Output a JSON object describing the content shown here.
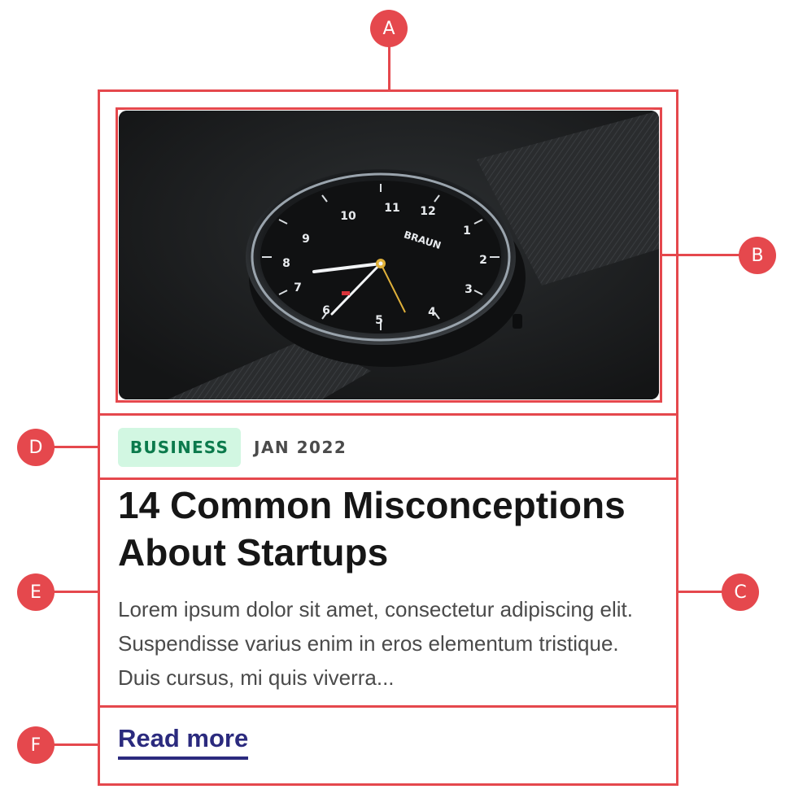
{
  "annotations": {
    "card": "A",
    "image": "B",
    "content": "C",
    "meta": "D",
    "text": "E",
    "action": "F",
    "color": "#e5484d"
  },
  "card": {
    "image": {
      "icon": "wristwatch-photo",
      "dial_brand": "BRAUN"
    },
    "category": "BUSINESS",
    "date": "JAN 2022",
    "title": "14 Common Misconceptions About Startups",
    "excerpt": "Lorem ipsum dolor sit amet, consectetur adipiscing elit. Suspendisse varius enim in eros elementum tristique. Duis cursus, mi quis viverra...",
    "read_more": "Read more"
  },
  "colors": {
    "badge_bg": "#d2f7e2",
    "badge_text": "#0b7a4c",
    "link": "#2b2a7e",
    "title": "#161616"
  }
}
